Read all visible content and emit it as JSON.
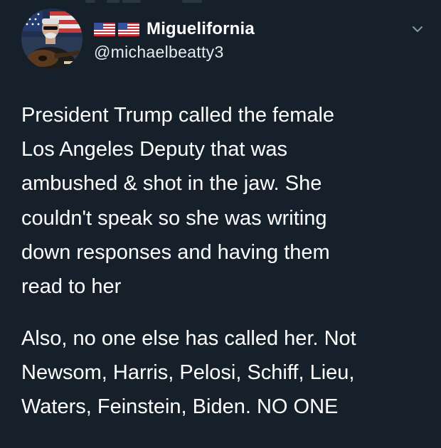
{
  "tweet": {
    "author": {
      "flags": [
        "us-flag",
        "us-flag"
      ],
      "display_name": "Miguelifornia",
      "handle": "@michaelbeatty3",
      "avatar_icon": "avatar-man-with-guitar-flag"
    },
    "menu_icon": "chevron-down-icon",
    "text_lines_1": [
      "President Trump called the female",
      "Los Angeles Deputy that was",
      "ambushed & shot in the jaw. She",
      "couldn't speak so she was writing",
      "down responses and having them",
      "read to her"
    ],
    "text_lines_2": [
      "Also, no one else has called her. Not",
      "Newsom, Harris, Pelosi, Schiff, Lieu,",
      "Waters, Feinstein, Biden. NO ONE"
    ]
  },
  "colors": {
    "background": "#15202b",
    "text": "#ffffff",
    "secondary_text": "#e7ecf0",
    "chevron": "#8899a6"
  }
}
